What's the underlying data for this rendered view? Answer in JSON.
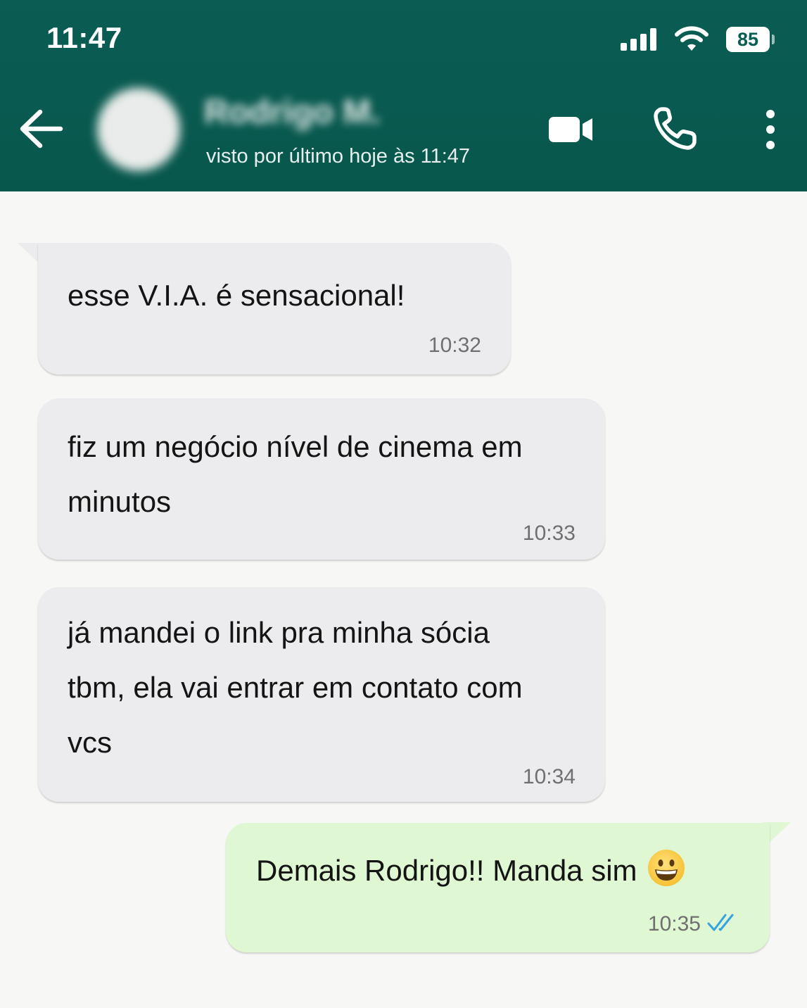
{
  "status_bar": {
    "time": "11:47",
    "battery": "85",
    "icons": [
      "signal-icon",
      "wifi-icon",
      "battery-icon"
    ]
  },
  "header": {
    "contact_name": "Rodrigo M.",
    "last_seen": "visto por último hoje às 11:47",
    "icons": [
      "back-arrow-icon",
      "avatar",
      "video-call-icon",
      "phone-call-icon",
      "more-options-icon"
    ],
    "background_color": "#075e54"
  },
  "messages": [
    {
      "direction": "incoming",
      "lines": [
        "esse V.I.A. é sensacional!"
      ],
      "time": "10:32"
    },
    {
      "direction": "incoming",
      "lines": [
        "fiz um negócio nível de cinema em",
        "minutos"
      ],
      "time": "10:33"
    },
    {
      "direction": "incoming",
      "lines": [
        "já mandei o link pra minha sócia",
        "tbm, ela vai entrar em contato com",
        "vcs"
      ],
      "time": "10:34"
    },
    {
      "direction": "outgoing",
      "text": "Demais Rodrigo!! Manda sim",
      "emoji": "grinning-face-icon",
      "time": "10:35",
      "status": "read-double-check-icon"
    }
  ],
  "colors": {
    "incoming_bubble": "#ececee",
    "outgoing_bubble": "#dff7d3",
    "read_tick": "#34b7f1",
    "background": "#f7f7f5"
  }
}
